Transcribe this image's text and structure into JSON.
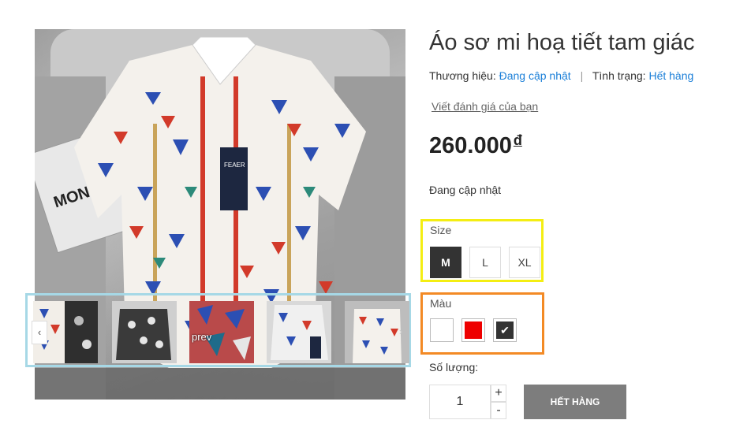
{
  "product": {
    "title": "Áo sơ mi hoạ tiết tam giác",
    "brand_label": "Thương hiệu:",
    "brand_value": "Đang cập nhật",
    "stock_label": "Tình trạng:",
    "stock_value": "Hết hàng",
    "separator": "|",
    "review_link": "Viết đánh giá của bạn",
    "price": "260.000",
    "currency": "đ",
    "status_text": "Đang cập nhật"
  },
  "gallery": {
    "prev_label": "prev",
    "prev_arrow": "‹",
    "next_arrow": "›"
  },
  "size": {
    "label": "Size",
    "options": [
      "M",
      "L",
      "XL"
    ],
    "selected": "M"
  },
  "color": {
    "label": "Màu",
    "options": [
      "#ffffff",
      "#ee0000",
      "#333333"
    ],
    "selected": "#333333"
  },
  "quantity": {
    "label": "Số lượng:",
    "value": "1",
    "plus": "+",
    "minus": "-"
  },
  "buy_button": "HẾT HÀNG",
  "colors": {
    "link": "#1b7fd8",
    "size_highlight": "#f4ee13",
    "color_highlight": "#f38a25",
    "thumb_highlight": "#a6d8e6",
    "buy_button_bg": "#7d7d7d"
  }
}
